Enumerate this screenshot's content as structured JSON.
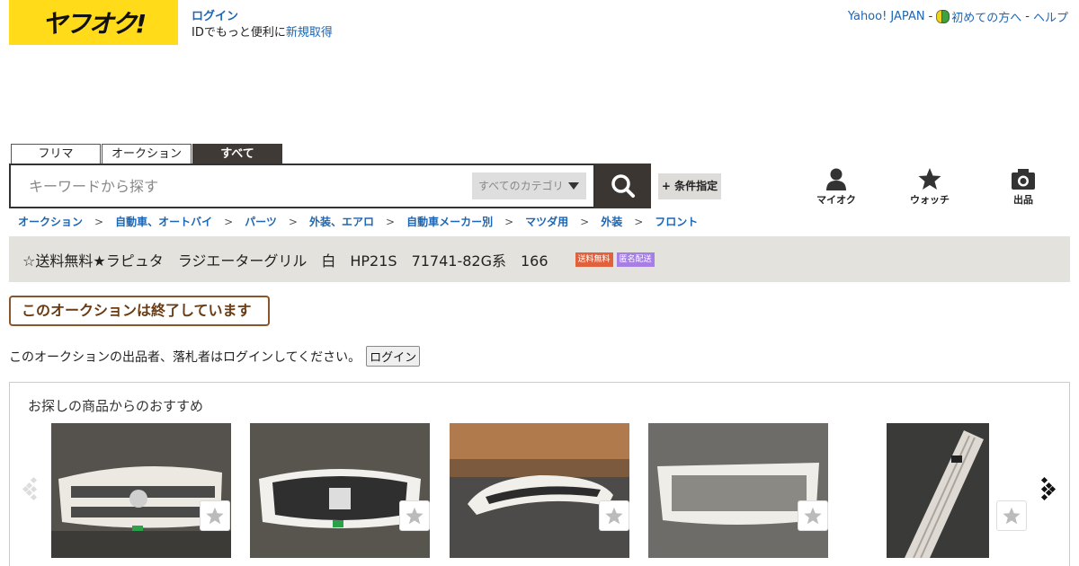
{
  "header": {
    "logo_text": "ヤフオク!",
    "login_link": "ログイン",
    "login_sub": "IDでもっと便利に",
    "register_link": "新規取得",
    "links": [
      "Yahoo! JAPAN",
      "初めての方へ",
      "ヘルプ"
    ],
    "sep": "-"
  },
  "search": {
    "tabs": [
      "フリマ",
      "オークション",
      "すべて"
    ],
    "placeholder": "キーワードから探す",
    "category": "すべてのカテゴリ",
    "condition_label": "+ 条件指定"
  },
  "nav_icons": {
    "myauc": "マイオク",
    "watch": "ウォッチ",
    "sell": "出品"
  },
  "breadcrumb": [
    "オークション",
    "自動車、オートバイ",
    "パーツ",
    "外装、エアロ",
    "自動車メーカー別",
    "マツダ用",
    "外装",
    "フロント"
  ],
  "breadcrumb_sep": ">",
  "item": {
    "title": "☆送料無料★ラピュタ　ラジエーターグリル　白　HP21S　71741-82G系　166",
    "badges": [
      "送料無料",
      "匿名配送"
    ]
  },
  "status": {
    "ended": "このオークションは終了しています",
    "notice": "このオークションの出品者、落札者はログインしてください。",
    "login_button": "ログイン"
  },
  "recommend": {
    "heading": "お探しの商品からのおすすめ"
  },
  "colors": {
    "brand_yellow": "#ffdb1a",
    "link_blue": "#1b66b5",
    "dark": "#3b3632",
    "free_shipping": "#e0613b",
    "anonymous": "#a67ee6"
  }
}
